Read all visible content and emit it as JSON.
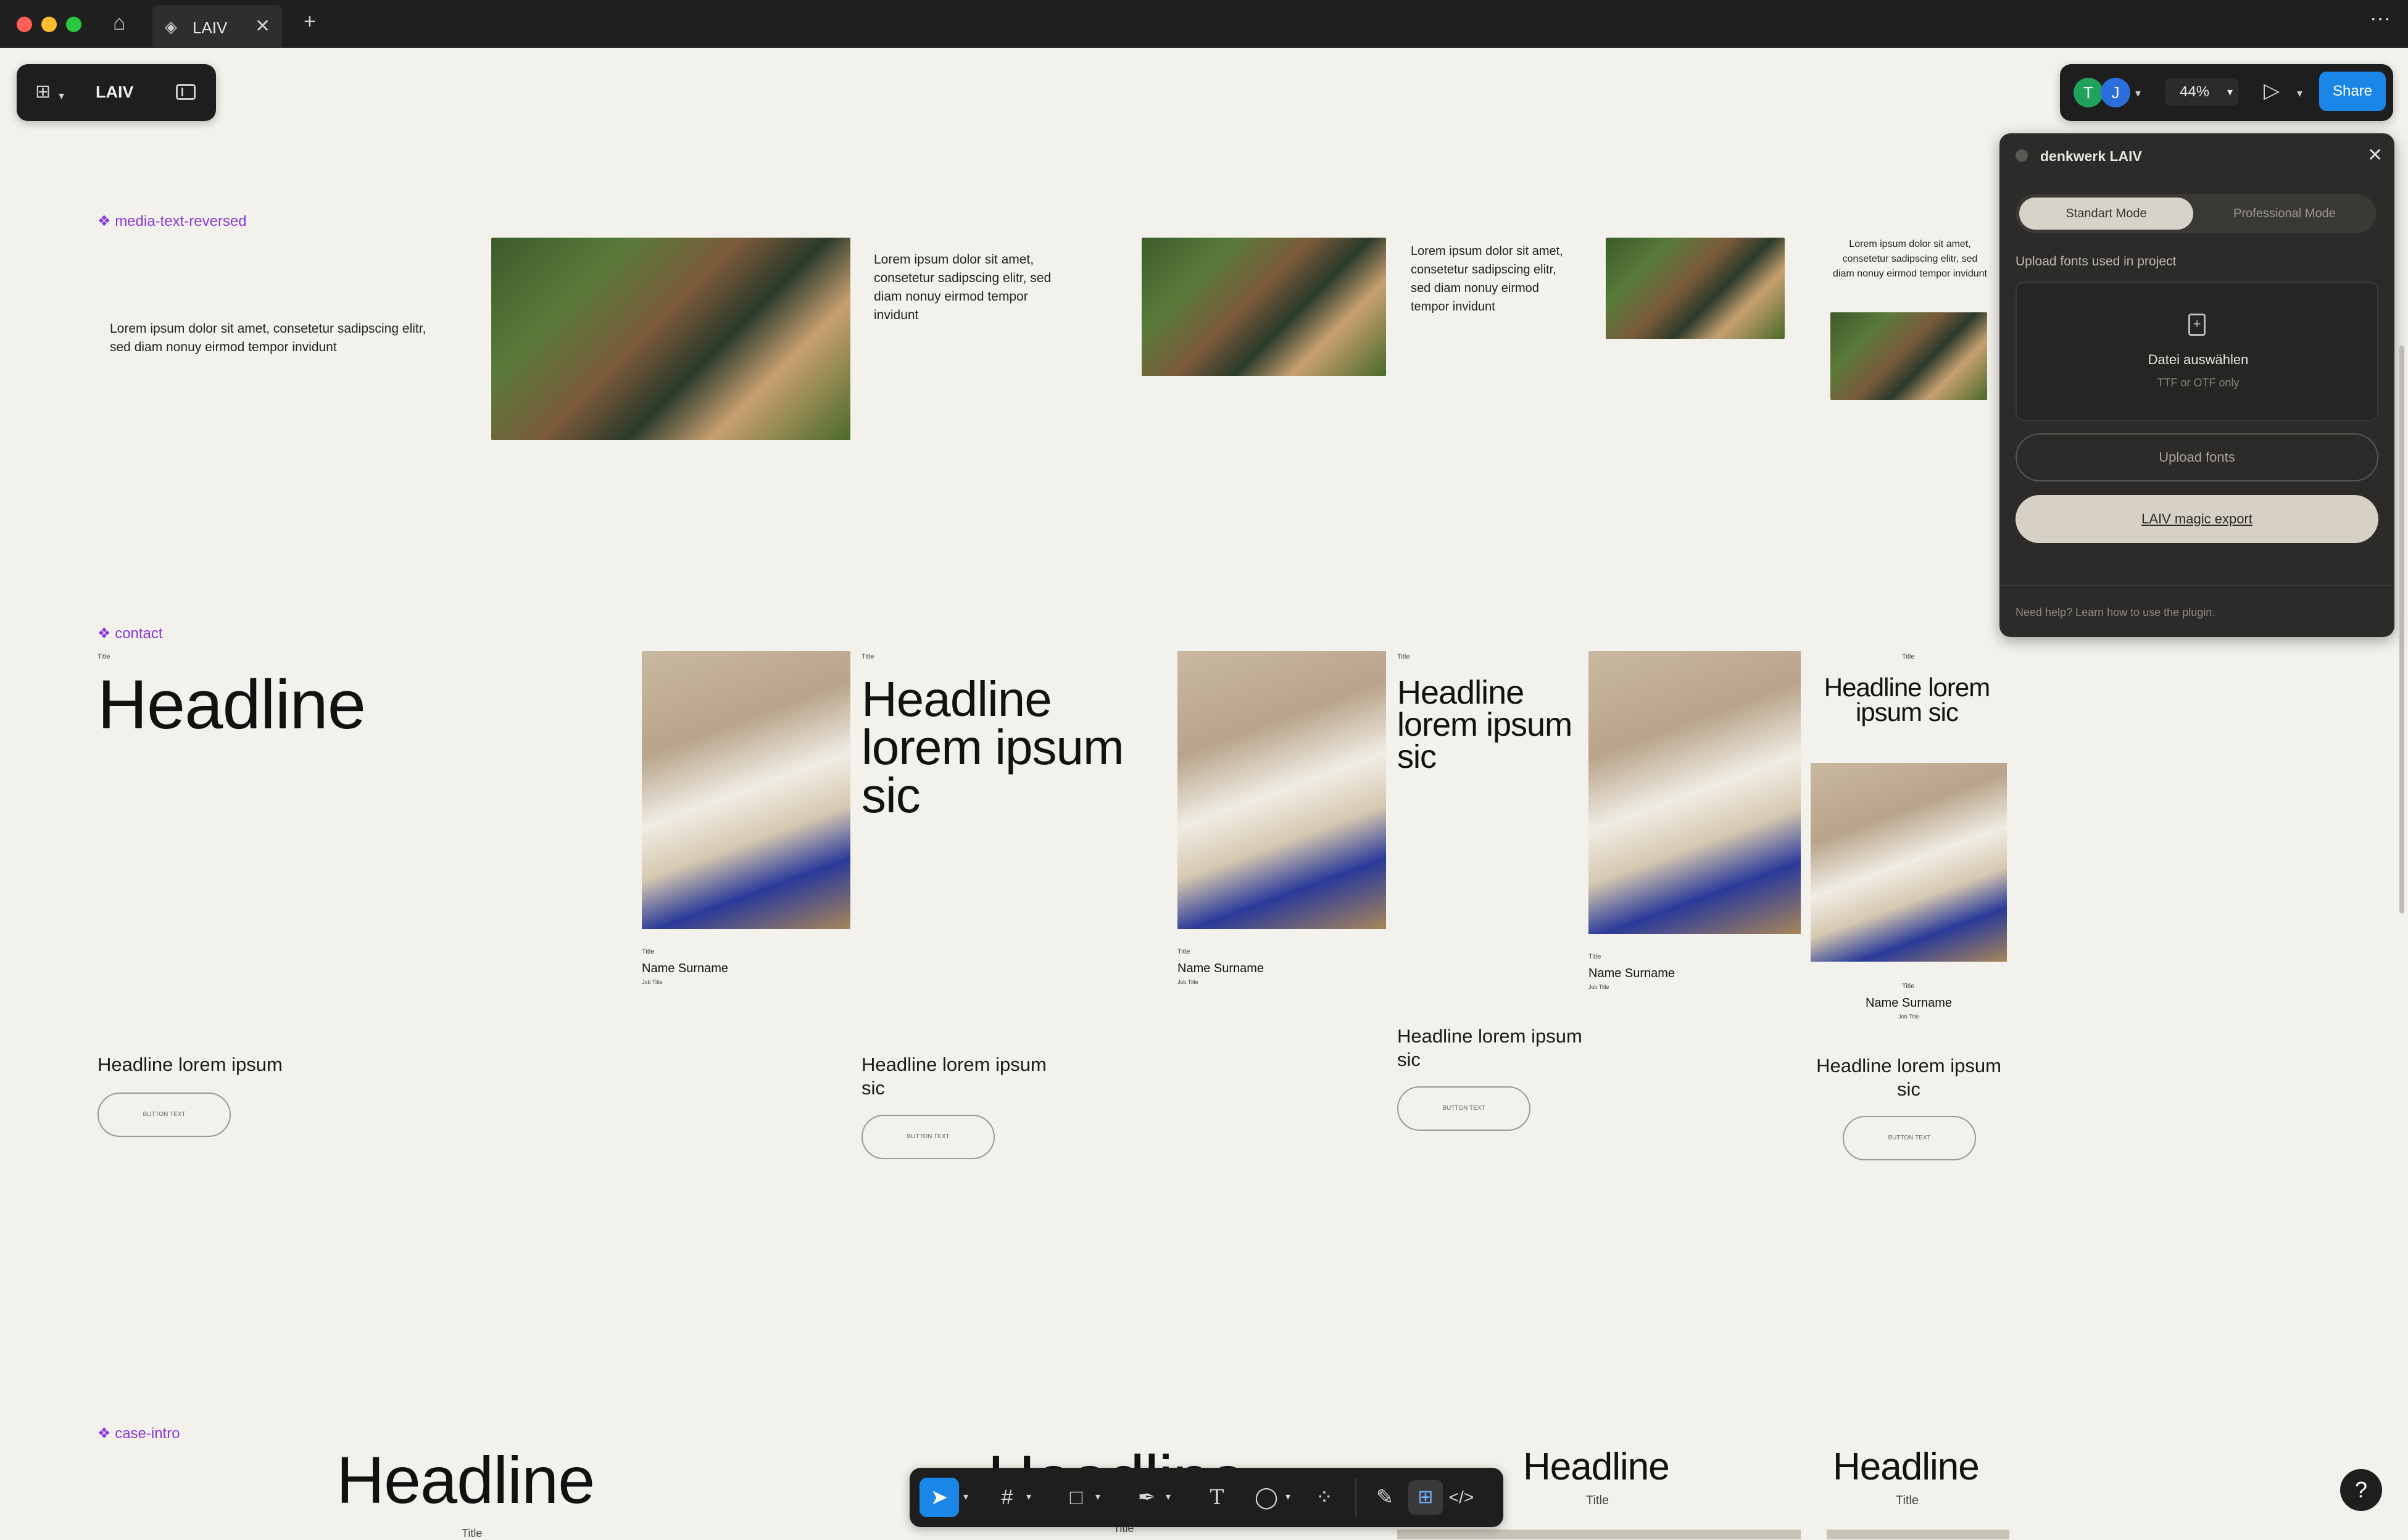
{
  "window": {
    "tab_title": "LAIV"
  },
  "file": {
    "name": "LAIV"
  },
  "right_toolbar": {
    "avatar_1": "T",
    "avatar_2": "J",
    "zoom": "44%",
    "share_label": "Share"
  },
  "canvas": {
    "section_media": "media-text-reversed",
    "section_contact": "contact",
    "section_case": "case-intro",
    "lorem_wide": "Lorem ipsum dolor sit amet, consetetur sadipscing elitr, sed diam nonuy eirmod tempor invidunt",
    "lorem_2": "Lorem ipsum dolor sit amet, consetetur sadipscing elitr, sed diam nonuy eirmod tempor invidunt",
    "lorem_3": "Lorem ipsum dolor sit amet, consetetur sadipscing elitr, sed diam nonuy eirmod tempor invidunt",
    "lorem_4": "Lorem ipsum dolor sit amet, consetetur sadipscing elitr, sed diam nonuy eirmod tempor invidunt",
    "title_small": "Title",
    "headline": "Headline",
    "headline_long": "Headline lorem ipsum sic",
    "sub_headline": "Headline lorem ipsum",
    "sub_headline_sic": "Headline lorem ipsum sic",
    "button_text": "BUTTON TEXT",
    "name_surname": "Name Surname",
    "job_title": "Job Title"
  },
  "plugin": {
    "title": "denkwerk LAIV",
    "mode_standard": "Standart Mode",
    "mode_professional": "Professional Mode",
    "upload_heading": "Upload fonts used in project",
    "choose_file": "Datei auswählen",
    "file_hint": "TTF or OTF only",
    "upload_button": "Upload fonts",
    "magic_export": "LAIV magic export",
    "help_text": "Need help? Learn how to use the plugin."
  },
  "colors": {
    "accent": "#1a86e8",
    "component_label": "#8b3ad7",
    "canvas": "#f3f1eb"
  }
}
